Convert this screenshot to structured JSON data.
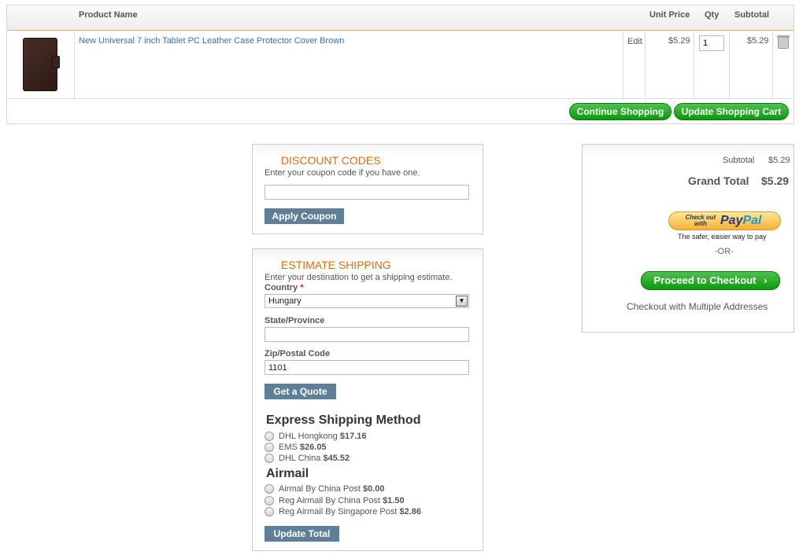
{
  "cart": {
    "headers": {
      "product_name": "Product Name",
      "unit_price": "Unit Price",
      "qty": "Qty",
      "subtotal": "Subtotal"
    },
    "item": {
      "name": "New Universal 7 inch Tablet PC Leather Case Protector Cover Brown",
      "edit": "Edit",
      "unit_price": "$5.29",
      "qty": "1",
      "subtotal": "$5.29"
    },
    "continue_label": "Continue Shopping",
    "update_label": "Update Shopping Cart"
  },
  "discount": {
    "title": "DISCOUNT CODES",
    "hint": "Enter your coupon code if you have one.",
    "value": "",
    "button": "Apply Coupon"
  },
  "shipping": {
    "title": "ESTIMATE SHIPPING",
    "hint": "Enter your destination to get a shipping estimate.",
    "country_label": "Country",
    "country_value": "Hungary",
    "state_label": "State/Province",
    "state_value": "",
    "zip_label": "Zip/Postal Code",
    "zip_value": "1101",
    "quote_button": "Get a Quote",
    "express_title": "Express Shipping Method",
    "express": [
      {
        "name": "DHL Hongkong",
        "price": "$17.16"
      },
      {
        "name": "EMS",
        "price": "$26.05"
      },
      {
        "name": "DHL China",
        "price": "$45.52"
      }
    ],
    "airmail_title": "Airmail",
    "airmail": [
      {
        "name": "Airmal By China Post",
        "price": "$0.00"
      },
      {
        "name": "Reg Airmail By China Post",
        "price": "$1.50"
      },
      {
        "name": "Reg Airmail By Singapore Post",
        "price": "$2.86"
      }
    ],
    "update_button": "Update Total"
  },
  "totals": {
    "subtotal_label": "Subtotal",
    "subtotal_value": "$5.29",
    "grand_label": "Grand Total",
    "grand_value": "$5.29",
    "paypal_small": "Check out with",
    "paypal_pay": "Pay",
    "paypal_pal": "Pal",
    "paypal_tagline": "The safer, easier way to pay",
    "or": "-OR-",
    "checkout_button": "Proceed to Checkout",
    "multiple": "Checkout with Multiple Addresses"
  }
}
